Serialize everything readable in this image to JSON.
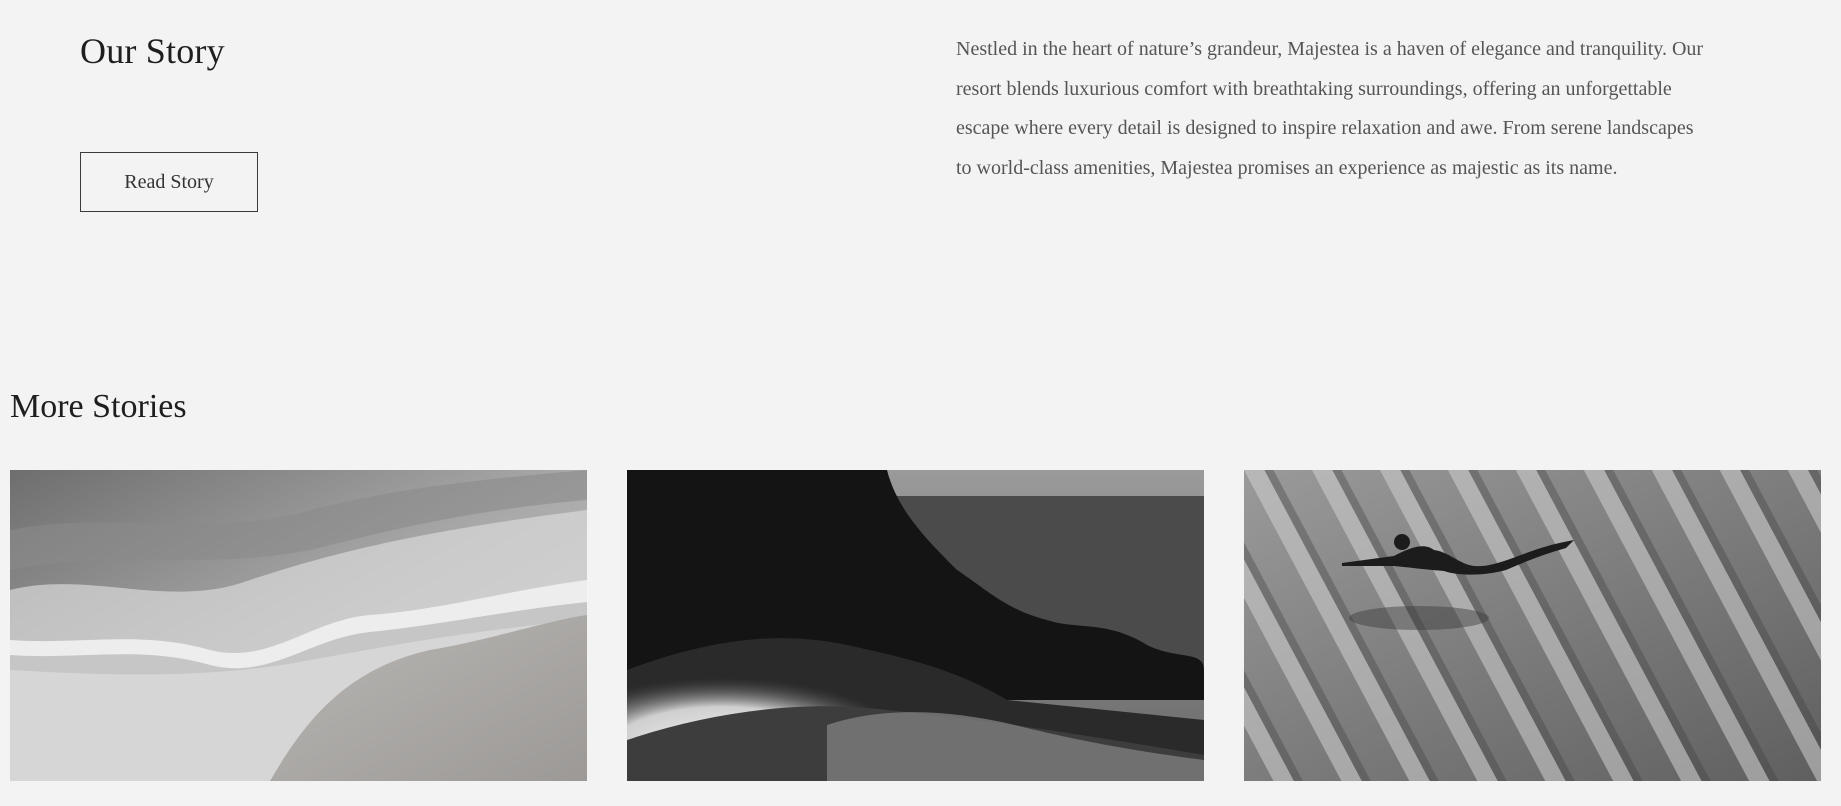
{
  "our_story": {
    "title": "Our Story",
    "button_label": "Read Story",
    "body": "Nestled in the heart of nature’s grandeur, Majestea is a haven of elegance and tranquility. Our resort blends luxurious comfort with breathtaking surroundings, offering an unforgettable escape where every detail is designed to inspire relaxation and awe. From serene landscapes to world-class amenities, Majestea promises an experience as majestic as its name."
  },
  "more_stories": {
    "title": "More Stories",
    "cards": [
      {
        "image": "aerial-ocean-waves-on-sand-photo"
      },
      {
        "image": "crashing-wave-by-rocky-cliff-photo"
      },
      {
        "image": "swimmer-over-rippled-sand-photo"
      }
    ]
  },
  "colors": {
    "background": "#f3f3f3",
    "heading": "#1e1e1e",
    "body_text": "#555555",
    "button_border": "#3a3a3a"
  }
}
